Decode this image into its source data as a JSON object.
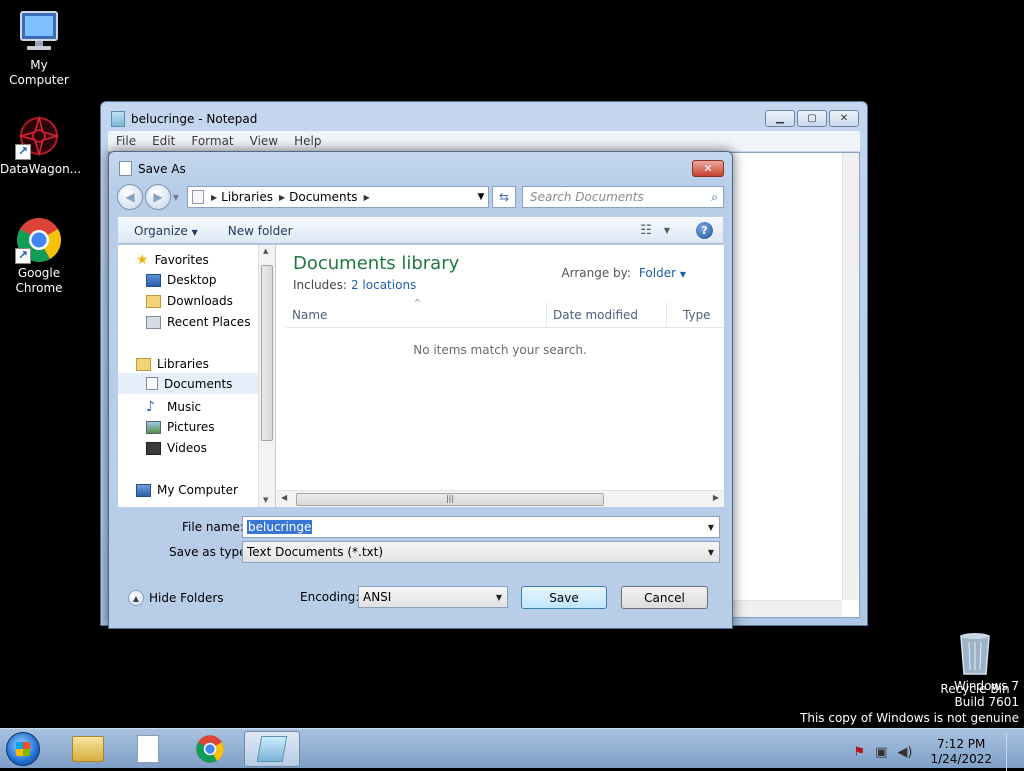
{
  "desktop": {
    "icons": [
      {
        "label": "My Computer"
      },
      {
        "label": "DataWagon..."
      },
      {
        "label": "Google Chrome"
      },
      {
        "label": "Recycle Bin"
      }
    ],
    "watermark": {
      "line1": "Windows 7",
      "line2": "Build 7601",
      "line3": "This copy of Windows is not genuine"
    }
  },
  "notepad": {
    "title": "belucringe - Notepad",
    "menu": [
      "File",
      "Edit",
      "Format",
      "View",
      "Help"
    ]
  },
  "dialog": {
    "title": "Save As",
    "address": [
      "Libraries",
      "Documents"
    ],
    "search_placeholder": "Search Documents",
    "toolbar": {
      "organize": "Organize",
      "new_folder": "New folder"
    },
    "nav": {
      "favorites": "Favorites",
      "desktop": "Desktop",
      "downloads": "Downloads",
      "recent": "Recent Places",
      "libraries": "Libraries",
      "documents": "Documents",
      "music": "Music",
      "pictures": "Pictures",
      "videos": "Videos",
      "computer": "My Computer"
    },
    "library_title": "Documents library",
    "includes_label": "Includes:",
    "includes_link": "2 locations",
    "arrange_label": "Arrange by:",
    "arrange_value": "Folder",
    "columns": [
      "Name",
      "Date modified",
      "Type"
    ],
    "empty_message": "No items match your search.",
    "file_name_label": "File name:",
    "file_name_value": "belucringe",
    "save_type_label": "Save as type:",
    "save_type_value": "Text Documents (*.txt)",
    "hide_folders": "Hide Folders",
    "encoding_label": "Encoding:",
    "encoding_value": "ANSI",
    "save_button": "Save",
    "cancel_button": "Cancel"
  },
  "taskbar": {
    "time": "7:12 PM",
    "date": "1/24/2022"
  }
}
